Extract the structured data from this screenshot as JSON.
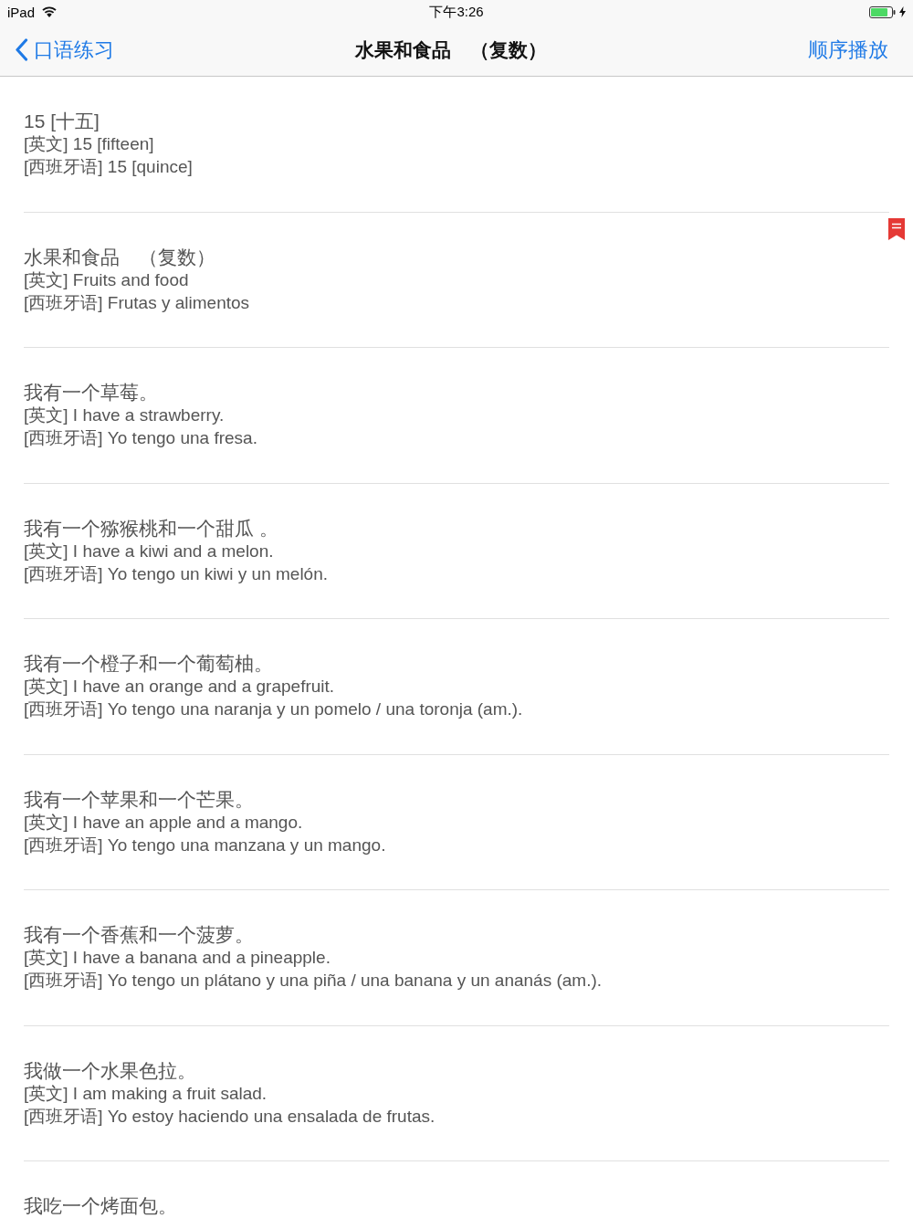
{
  "status_bar": {
    "device": "iPad",
    "time": "下午3:26"
  },
  "nav_bar": {
    "back_label": "口语练习",
    "title": "水果和食品　（复数）",
    "action": "顺序播放"
  },
  "items": [
    {
      "chinese": "15 [十五]",
      "english": "[英文] 15 [fifteen]",
      "spanish": "[西班牙语] 15 [quince]",
      "bookmarked": false
    },
    {
      "chinese": "水果和食品　（复数）",
      "english": "[英文] Fruits and food",
      "spanish": "[西班牙语] Frutas y alimentos",
      "bookmarked": true
    },
    {
      "chinese": "我有一个草莓。",
      "english": "[英文] I have a strawberry.",
      "spanish": "[西班牙语] Yo tengo una fresa.",
      "bookmarked": false
    },
    {
      "chinese": "我有一个猕猴桃和一个甜瓜 。",
      "english": "[英文] I have a kiwi and a melon.",
      "spanish": "[西班牙语] Yo tengo un kiwi y un melón.",
      "bookmarked": false
    },
    {
      "chinese": "我有一个橙子和一个葡萄柚。",
      "english": "[英文] I have an orange and a grapefruit.",
      "spanish": "[西班牙语] Yo tengo una naranja y un pomelo / una toronja (am.).",
      "bookmarked": false
    },
    {
      "chinese": "我有一个苹果和一个芒果。",
      "english": "[英文] I have an apple and a mango.",
      "spanish": "[西班牙语] Yo tengo una manzana y un mango.",
      "bookmarked": false
    },
    {
      "chinese": "我有一个香蕉和一个菠萝。",
      "english": "[英文] I have a banana and a pineapple.",
      "spanish": "[西班牙语] Yo tengo un plátano y una piña / una banana y un ananás (am.).",
      "bookmarked": false
    },
    {
      "chinese": "我做一个水果色拉。",
      "english": "[英文] I am making a fruit salad.",
      "spanish": "[西班牙语] Yo estoy haciendo una ensalada de frutas.",
      "bookmarked": false
    },
    {
      "chinese": "我吃一个烤面包。",
      "bookmarked": false
    }
  ]
}
